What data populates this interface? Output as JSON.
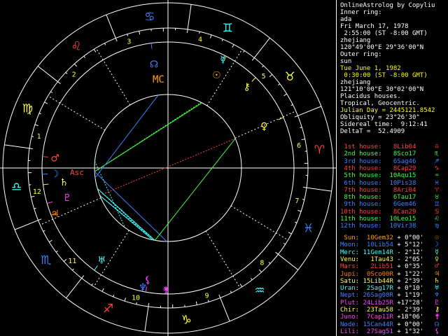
{
  "header": {
    "title": "OnlineAstrolog by Copyliu",
    "inner_label": "Inner ring:",
    "inner_name": "ada",
    "inner_date": "Fri March 17, 1978",
    "inner_time": " 2:55:00 (ST -8:00 GMT)",
    "inner_place": "zhejiang",
    "inner_coords": "120°49'00\"E 29°36'00\"N",
    "outer_label": "Outer ring:",
    "outer_name": "sun",
    "outer_date": "Tue June 1, 1982",
    "outer_time": " 0:30:00 (ST -8:00 GMT)",
    "outer_place": "zhejiang",
    "outer_coords": "121°10'00\"E 30°02'00\"N",
    "houses": "Placidus houses.",
    "zodiac": "Tropical, Geocentric.",
    "julian": "Julian Day = 2445121.8542",
    "obliquity": "Obliquity = 23°26'30\"",
    "sidereal": "Sidereal time:  9:12:41",
    "deltat": "DeltaT =  52.4909"
  },
  "house_cusps": [
    {
      "label": "1st house:",
      "value": "8Lib04",
      "color": "#ff4040",
      "glyph": "♎"
    },
    {
      "label": "2nd house:",
      "value": "8Sco17",
      "color": "#40ff40",
      "glyph": "♏"
    },
    {
      "label": "3rd house:",
      "value": "6Sag46",
      "color": "#4080ff",
      "glyph": "♐"
    },
    {
      "label": "4th house:",
      "value": "8Cap29",
      "color": "#ff4040",
      "glyph": "♑"
    },
    {
      "label": "5th house:",
      "value": "10Aqu15",
      "color": "#40ff40",
      "glyph": "♒"
    },
    {
      "label": "6th house:",
      "value": "10Pis38",
      "color": "#4080ff",
      "glyph": "♓"
    },
    {
      "label": "7th house:",
      "value": "8Ari04",
      "color": "#ff4040",
      "glyph": "♈"
    },
    {
      "label": "8th house:",
      "value": "6Tau17",
      "color": "#40ff40",
      "glyph": "♉"
    },
    {
      "label": "9th house:",
      "value": "6Gem46",
      "color": "#4080ff",
      "glyph": "♊"
    },
    {
      "label": "10th house:",
      "value": "8Can29",
      "color": "#ff4040",
      "glyph": "♋"
    },
    {
      "label": "11th house:",
      "value": "10Leo15",
      "color": "#40ff40",
      "glyph": "♌"
    },
    {
      "label": "12th house:",
      "value": "10Vir38",
      "color": "#4080ff",
      "glyph": "♍"
    }
  ],
  "planets": [
    {
      "name": "Sun:",
      "pos": "10Gem32",
      "lat": "+ 0°00'",
      "color": "#ffa000",
      "glyph": "☉"
    },
    {
      "name": "Moon:",
      "pos": "10Lib54",
      "lat": "+ 5°12'",
      "color": "#4080ff",
      "glyph": "☽"
    },
    {
      "name": "Merc:",
      "pos": "11Gem14R",
      "lat": "- 2°12'",
      "color": "#40ffff",
      "glyph": "☿"
    },
    {
      "name": "Venu:",
      "pos": "1Tau43",
      "lat": "- 2°05'",
      "color": "#ffff40",
      "glyph": "♀"
    },
    {
      "name": "Mars:",
      "pos": "2Lib51",
      "lat": "+ 0°35'",
      "color": "#ff4040",
      "glyph": "♂"
    },
    {
      "name": "Jupi:",
      "pos": "0Sco00R",
      "lat": "+ 1°22'",
      "color": "#ff8000",
      "glyph": "♃"
    },
    {
      "name": "Satu:",
      "pos": "15Lib44R",
      "lat": "+ 2°39'",
      "color": "#ffff40",
      "glyph": "♄"
    },
    {
      "name": "Uran:",
      "pos": "2Sag17R",
      "lat": "+ 0°10'",
      "color": "#40ffff",
      "glyph": "♅"
    },
    {
      "name": "Nept:",
      "pos": "26Sag08R",
      "lat": "+ 1°19'",
      "color": "#4080ff",
      "glyph": "♆"
    },
    {
      "name": "Plut:",
      "pos": "24Lib25R",
      "lat": "+17°28'",
      "color": "#ff40ff",
      "glyph": "♇"
    },
    {
      "name": "Chir:",
      "pos": "23Tau58",
      "lat": "- 2°39'",
      "color": "#ffff40",
      "glyph": "⚷"
    },
    {
      "name": "Juno:",
      "pos": "7Cap11R",
      "lat": "+18°06'",
      "color": "#ff40ff",
      "glyph": "⚵"
    },
    {
      "name": "Node:",
      "pos": "15Can44R",
      "lat": "+ 0°00'",
      "color": "#4080ff",
      "glyph": "☊"
    },
    {
      "name": "Lili:",
      "pos": "27Sag51",
      "lat": "+ 1°32'",
      "color": "#ff40ff",
      "glyph": "⚸"
    }
  ],
  "wheel": {
    "signs": [
      {
        "glyph": "♈",
        "color": "#ff4040"
      },
      {
        "glyph": "♉",
        "color": "#ffff40"
      },
      {
        "glyph": "♊",
        "color": "#40ffff"
      },
      {
        "glyph": "♋",
        "color": "#4080ff"
      },
      {
        "glyph": "♌",
        "color": "#ff4040"
      },
      {
        "glyph": "♍",
        "color": "#ffff40"
      },
      {
        "glyph": "♎",
        "color": "#40ffff"
      },
      {
        "glyph": "♏",
        "color": "#4080ff"
      },
      {
        "glyph": "♐",
        "color": "#ff4040"
      },
      {
        "glyph": "♑",
        "color": "#ffff40"
      },
      {
        "glyph": "♒",
        "color": "#40ffff"
      },
      {
        "glyph": "♓",
        "color": "#4080ff"
      }
    ],
    "house_numbers": [
      "1",
      "2",
      "3",
      "4",
      "5",
      "6",
      "7",
      "8",
      "9",
      "10",
      "11",
      "12"
    ],
    "angle_labels": {
      "asc": "Asc",
      "mc": "MC"
    },
    "colors": {
      "fire": "#ff4040",
      "earth": "#ffff40",
      "air": "#40ffff",
      "water": "#4080ff"
    }
  }
}
